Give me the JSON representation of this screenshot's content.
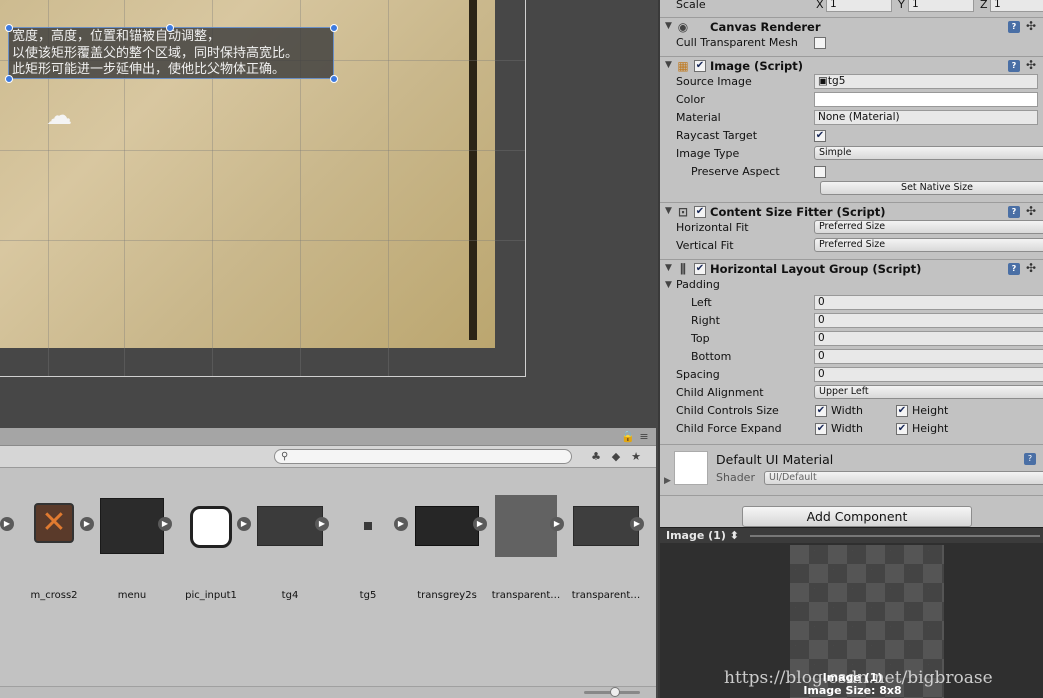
{
  "scene": {
    "tooltip_lines": [
      "宽度，高度，位置和锚被自动调整，",
      "以使该矩形覆盖父的整个区域，同时保持高宽比。",
      "此矩形可能进一步延伸出，使他比父物体正确。"
    ]
  },
  "project": {
    "search_placeholder": "",
    "assets": [
      {
        "label": "m_cross2"
      },
      {
        "label": "menu"
      },
      {
        "label": "pic_input1"
      },
      {
        "label": "tg4"
      },
      {
        "label": "tg5"
      },
      {
        "label": "transgrey2s"
      },
      {
        "label": "transparent…"
      },
      {
        "label": "transparent…"
      }
    ]
  },
  "inspector": {
    "transform": {
      "scale_label": "Scale",
      "x_label": "X",
      "x": "1",
      "y_label": "Y",
      "y": "1",
      "z_label": "Z",
      "z": "1"
    },
    "canvas_renderer": {
      "title": "Canvas Renderer",
      "cull_label": "Cull Transparent Mesh"
    },
    "image": {
      "title": "Image (Script)",
      "source_label": "Source Image",
      "source_value": "tg5",
      "color_label": "Color",
      "material_label": "Material",
      "material_value": "None (Material)",
      "raycast_label": "Raycast Target",
      "type_label": "Image Type",
      "type_value": "Simple",
      "preserve_label": "Preserve Aspect",
      "native_button": "Set Native Size"
    },
    "csf": {
      "title": "Content Size Fitter (Script)",
      "hfit_label": "Horizontal Fit",
      "hfit_value": "Preferred Size",
      "vfit_label": "Vertical Fit",
      "vfit_value": "Preferred Size"
    },
    "hlg": {
      "title": "Horizontal Layout Group (Script)",
      "padding_label": "Padding",
      "left_label": "Left",
      "left": "0",
      "right_label": "Right",
      "right": "0",
      "top_label": "Top",
      "top": "0",
      "bottom_label": "Bottom",
      "bottom": "0",
      "spacing_label": "Spacing",
      "spacing": "0",
      "align_label": "Child Alignment",
      "align_value": "Upper Left",
      "controls_label": "Child Controls Size",
      "expand_label": "Child Force Expand",
      "width_label": "Width",
      "height_label": "Height"
    },
    "material": {
      "name": "Default UI Material",
      "shader_label": "Shader",
      "shader_value": "UI/Default"
    },
    "add_component": "Add Component",
    "preview": {
      "title": "Image (1)",
      "caption_name": "Image (1)",
      "caption_size": "Image Size: 8x8",
      "watermark": "https://blog.csdn.net/bigbroase"
    }
  },
  "colors": {
    "handle": "#3d7ae0",
    "help_icon": "#4a6fa5"
  }
}
